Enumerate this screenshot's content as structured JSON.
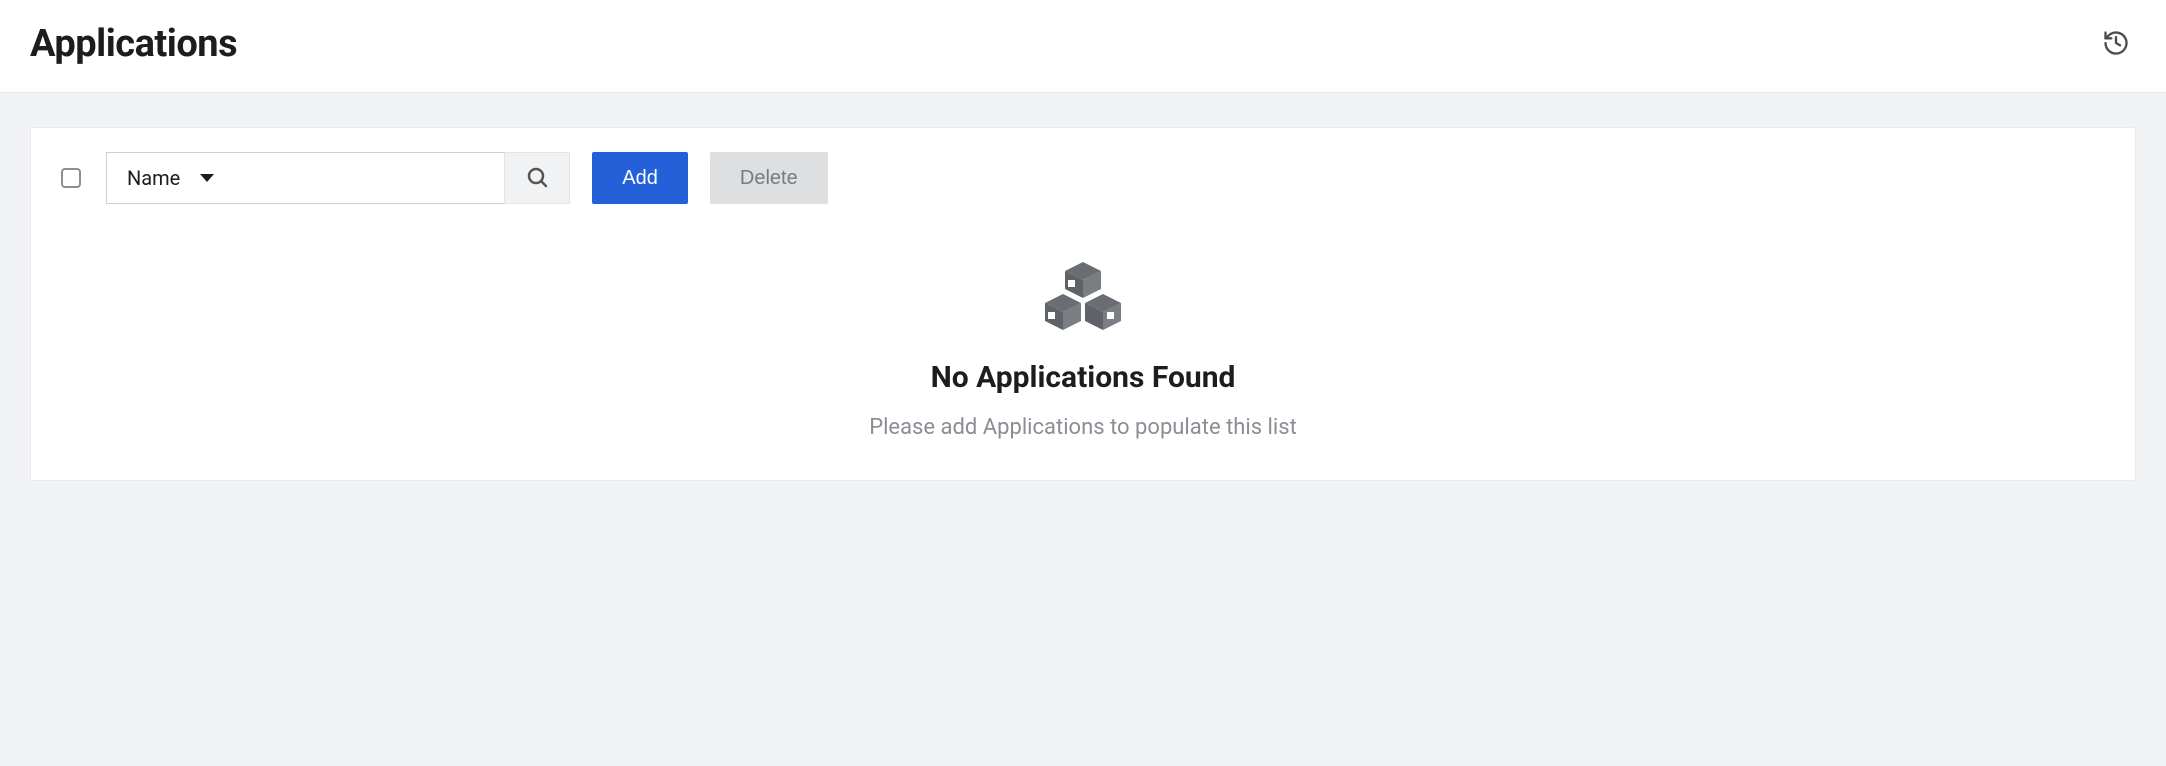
{
  "header": {
    "title": "Applications"
  },
  "toolbar": {
    "filter_selected": "Name",
    "search_value": "",
    "search_placeholder": "",
    "add_label": "Add",
    "delete_label": "Delete"
  },
  "empty_state": {
    "title": "No Applications Found",
    "subtitle": "Please add Applications to populate this list"
  }
}
